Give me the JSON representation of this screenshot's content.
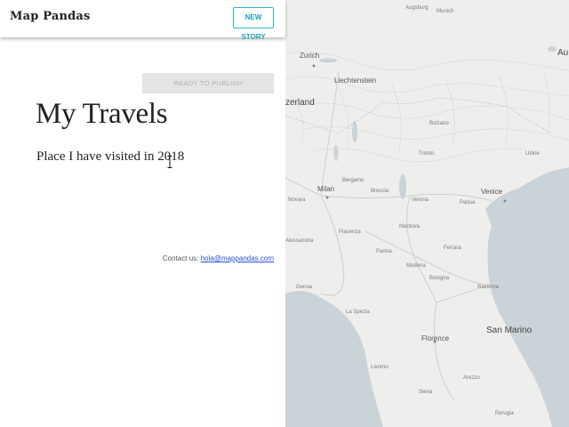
{
  "app": {
    "brand": "Map Pandas",
    "new_story_label": "NEW STORY"
  },
  "editor": {
    "publish_label": "READY TO PUBLISH",
    "title": "My Travels",
    "subtitle": "Place I have visited in 2018",
    "contact_prefix": "Contact us:",
    "contact_email": "hola@mappandas.com"
  },
  "map": {
    "land_color": "#eeeeec",
    "water_color": "#c9d3d8",
    "road_color": "#d0d0d0",
    "labels": [
      {
        "text": "Augsburg",
        "size": "small"
      },
      {
        "text": "Munich",
        "size": "small"
      },
      {
        "text": "Zurich",
        "size": "mid"
      },
      {
        "text": "Au",
        "size": "big"
      },
      {
        "text": "Liechtenstein",
        "size": "mid"
      },
      {
        "text": "zerland",
        "size": "big"
      },
      {
        "text": "Bolzano",
        "size": "small"
      },
      {
        "text": "Trento",
        "size": "small"
      },
      {
        "text": "Udine",
        "size": "small"
      },
      {
        "text": "Milan",
        "size": "mid"
      },
      {
        "text": "Bergamo",
        "size": "small"
      },
      {
        "text": "Brescia",
        "size": "small"
      },
      {
        "text": "Novara",
        "size": "small"
      },
      {
        "text": "Verona",
        "size": "small"
      },
      {
        "text": "Padua",
        "size": "small"
      },
      {
        "text": "Venice",
        "size": "mid"
      },
      {
        "text": "Parma",
        "size": "small"
      },
      {
        "text": "Ferrara",
        "size": "small"
      },
      {
        "text": "Modena",
        "size": "small"
      },
      {
        "text": "Bologna",
        "size": "small"
      },
      {
        "text": "Ravenna",
        "size": "small"
      },
      {
        "text": "Genoa",
        "size": "small"
      },
      {
        "text": "La Spezia",
        "size": "small"
      },
      {
        "text": "San Marino",
        "size": "big"
      },
      {
        "text": "Florence",
        "size": "mid"
      },
      {
        "text": "Livorno",
        "size": "small"
      },
      {
        "text": "Siena",
        "size": "small"
      },
      {
        "text": "Arezzo",
        "size": "small"
      },
      {
        "text": "Perugia",
        "size": "small"
      },
      {
        "text": "Alessandria",
        "size": "small"
      },
      {
        "text": "Piacenza",
        "size": "small"
      },
      {
        "text": "Mantova",
        "size": "small"
      }
    ]
  }
}
